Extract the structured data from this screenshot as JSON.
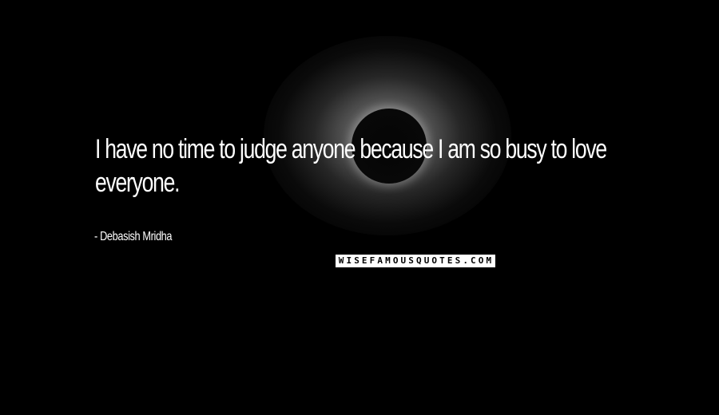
{
  "quote": {
    "line1": "I have no time to judge anyone because I am so busy to love",
    "line2": "everyone."
  },
  "author": {
    "dash": "-",
    "name": "Debasish Mridha"
  },
  "watermark": {
    "text": "WISEFAMOUSQUOTES.COM"
  },
  "colors": {
    "background": "#000000",
    "text": "#ffffff"
  }
}
